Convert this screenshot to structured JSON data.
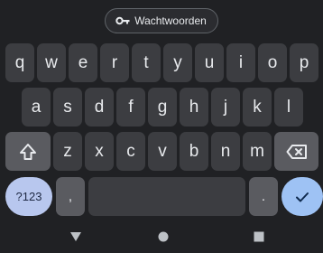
{
  "suggestion": {
    "chip_label": "Wachtwoorden",
    "chip_icon": "key-icon"
  },
  "rows": [
    [
      "q",
      "w",
      "e",
      "r",
      "t",
      "y",
      "u",
      "i",
      "o",
      "p"
    ],
    [
      "a",
      "s",
      "d",
      "f",
      "g",
      "h",
      "j",
      "k",
      "l"
    ],
    [
      "z",
      "x",
      "c",
      "v",
      "b",
      "n",
      "m"
    ]
  ],
  "keys": {
    "shift_icon": "shift-icon",
    "backspace_icon": "backspace-icon",
    "symbols_label": "?123",
    "comma_label": ",",
    "period_label": ".",
    "enter_icon": "checkmark-icon"
  },
  "navigation": {
    "back_icon": "back-triangle-icon",
    "home_icon": "home-circle-icon",
    "recents_icon": "recents-square-icon"
  },
  "colors": {
    "background": "#202124",
    "key": "#3c3d41",
    "function_key": "#5a5b60",
    "symbols_key": "#b8c7ee",
    "enter_key": "#9ec2f4"
  }
}
